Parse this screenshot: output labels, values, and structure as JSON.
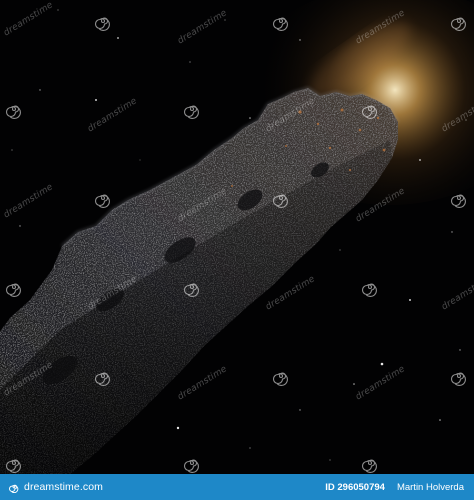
{
  "image": {
    "subject": "dark elongated asteroid in star field",
    "colors": {
      "background": "#000000",
      "rock": "#2a2a2c",
      "rim_light": "#f0b458",
      "footer": "#1e88c8"
    }
  },
  "watermark": {
    "text": "dreamstime",
    "icon": "swirl-icon"
  },
  "footer": {
    "brand": "dreamstime.com",
    "brand_icon": "swirl-icon",
    "id_label": "ID 296050794",
    "author": "Martin Holverda"
  }
}
